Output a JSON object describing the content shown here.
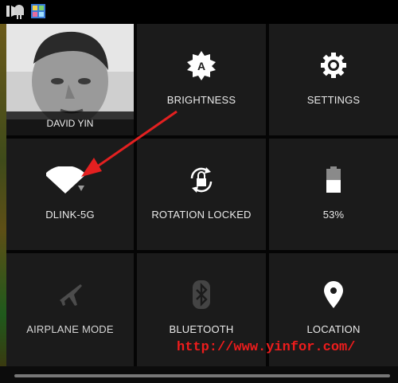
{
  "status_bar": {
    "icons": [
      "notification-icon",
      "android-icon",
      "app-icon"
    ]
  },
  "user": {
    "name": "DAVID YIN"
  },
  "tiles": {
    "brightness": {
      "label": "BRIGHTNESS",
      "icon": "brightness-auto-icon"
    },
    "settings": {
      "label": "SETTINGS",
      "icon": "gear-icon"
    },
    "wifi": {
      "label": "DLINK-5G",
      "icon": "wifi-icon"
    },
    "rotation": {
      "label": "ROTATION LOCKED",
      "icon": "rotation-lock-icon"
    },
    "battery": {
      "label": "53%",
      "icon": "battery-icon",
      "level": 0.53
    },
    "airplane": {
      "label": "AIRPLANE MODE",
      "icon": "airplane-icon"
    },
    "bluetooth": {
      "label": "BLUETOOTH",
      "icon": "bluetooth-icon"
    },
    "location": {
      "label": "LOCATION",
      "icon": "location-pin-icon"
    }
  },
  "watermark": {
    "url": "http://www.yinfor.com/"
  },
  "colors": {
    "annotation_red": "#e32020",
    "tile_bg": "#1b1b1b"
  }
}
